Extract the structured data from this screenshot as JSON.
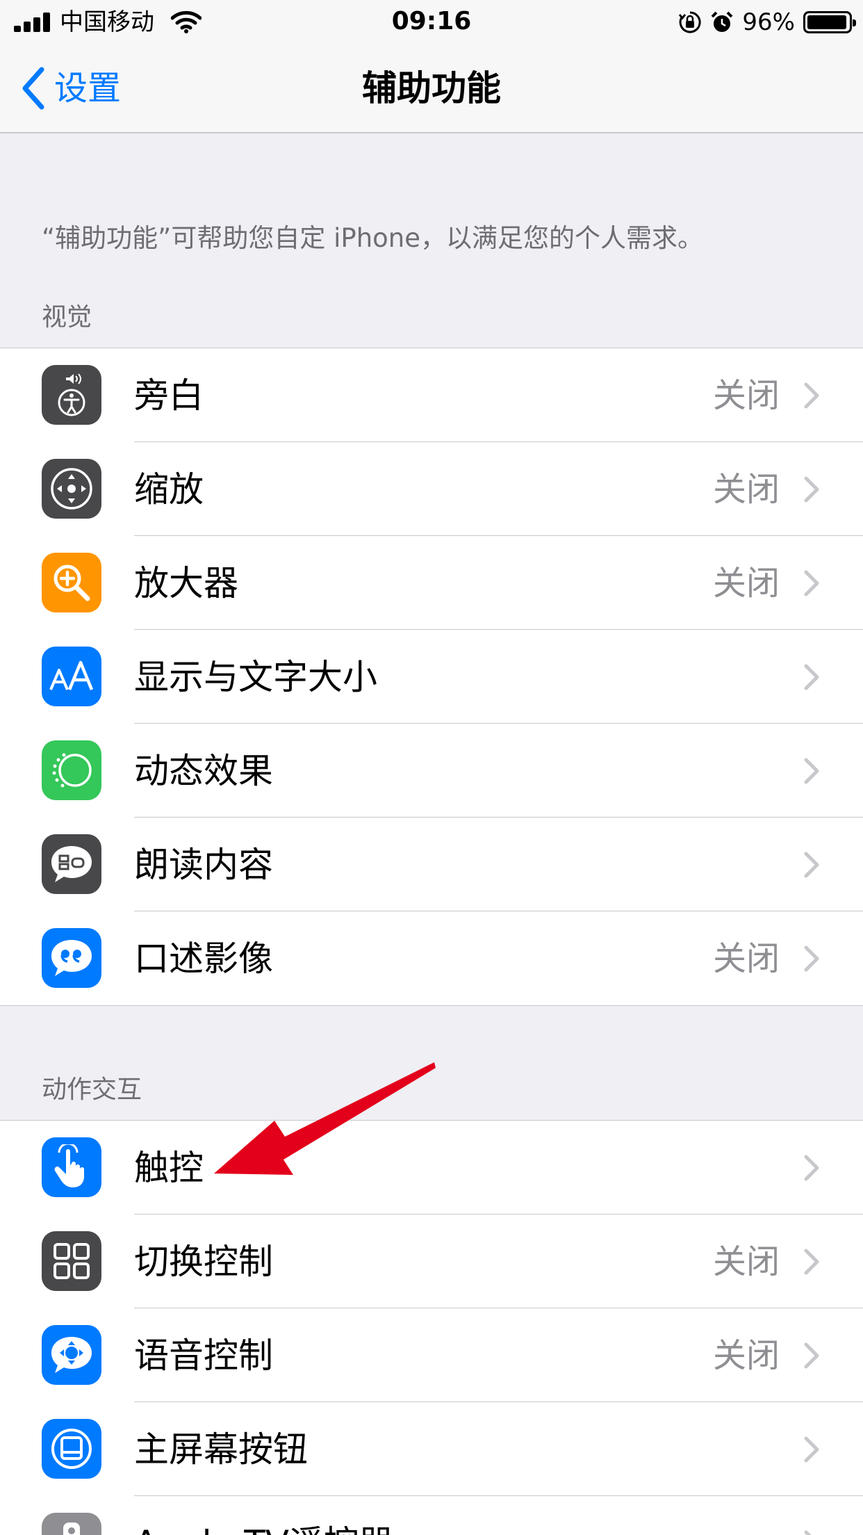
{
  "status_bar": {
    "carrier": "中国移动",
    "time": "09:16",
    "battery_percent": "96%",
    "battery_level": 0.96
  },
  "nav": {
    "back_label": "设置",
    "title": "辅助功能"
  },
  "intro_text": "“辅助功能”可帮助您自定 iPhone，以满足您的个人需求。",
  "sections": [
    {
      "header": "视觉",
      "items": [
        {
          "label": "旁白",
          "value": "关闭",
          "icon": "voiceover-icon",
          "color": "#48484a"
        },
        {
          "label": "缩放",
          "value": "关闭",
          "icon": "zoom-icon",
          "color": "#48484a"
        },
        {
          "label": "放大器",
          "value": "关闭",
          "icon": "magnifier-icon",
          "color": "#ff9500"
        },
        {
          "label": "显示与文字大小",
          "value": "",
          "icon": "text-size-icon",
          "color": "#007aff"
        },
        {
          "label": "动态效果",
          "value": "",
          "icon": "motion-icon",
          "color": "#34c759"
        },
        {
          "label": "朗读内容",
          "value": "",
          "icon": "speech-bubble-icon",
          "color": "#48484a"
        },
        {
          "label": "口述影像",
          "value": "关闭",
          "icon": "quote-bubble-icon",
          "color": "#007aff"
        }
      ]
    },
    {
      "header": "动作交互",
      "items": [
        {
          "label": "触控",
          "value": "",
          "icon": "hand-pointer-icon",
          "color": "#007aff"
        },
        {
          "label": "切换控制",
          "value": "关闭",
          "icon": "grid-icon",
          "color": "#48484a"
        },
        {
          "label": "语音控制",
          "value": "关闭",
          "icon": "voice-control-icon",
          "color": "#007aff"
        },
        {
          "label": "主屏幕按钮",
          "value": "",
          "icon": "home-button-icon",
          "color": "#007aff"
        },
        {
          "label": "Apple TV遥控器",
          "value": "",
          "icon": "remote-icon",
          "color": "#8e8e93"
        }
      ]
    }
  ],
  "annotation_color": "#e3001b"
}
